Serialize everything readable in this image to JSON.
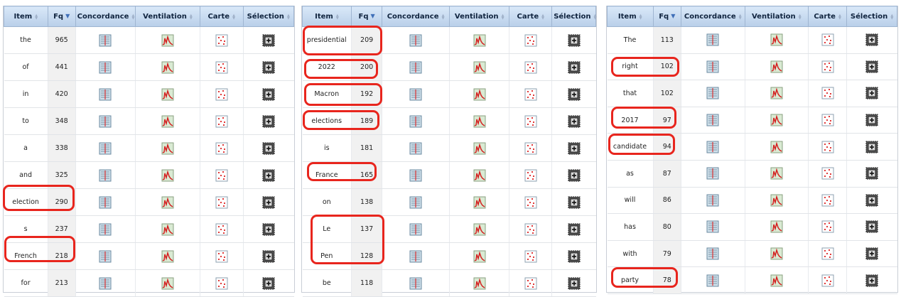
{
  "columns": {
    "item": "Item",
    "fq": "Fq",
    "concordance": "Concordance",
    "ventilation": "Ventilation",
    "carte": "Carte",
    "selection": "Sélection"
  },
  "icons": {
    "concordance": "concordance-icon",
    "ventilation": "ventilation-chart-icon",
    "carte": "map-dots-icon",
    "selection": "select-plus-icon"
  },
  "colors": {
    "highlight": "#e8251d",
    "header_top": "#d9e8f8",
    "header_bottom": "#b9cfe9",
    "sort_active": "#3f6fb8"
  },
  "panels": [
    {
      "rows": [
        {
          "item": "the",
          "fq": "965"
        },
        {
          "item": "of",
          "fq": "441"
        },
        {
          "item": "in",
          "fq": "420"
        },
        {
          "item": "to",
          "fq": "348"
        },
        {
          "item": "a",
          "fq": "338"
        },
        {
          "item": "and",
          "fq": "325"
        },
        {
          "item": "election",
          "fq": "290"
        },
        {
          "item": "s",
          "fq": "237"
        },
        {
          "item": "French",
          "fq": "218"
        },
        {
          "item": "for",
          "fq": "213"
        }
      ]
    },
    {
      "rows": [
        {
          "item": "presidential",
          "fq": "209"
        },
        {
          "item": "2022",
          "fq": "200"
        },
        {
          "item": "Macron",
          "fq": "192"
        },
        {
          "item": "elections",
          "fq": "189"
        },
        {
          "item": "is",
          "fq": "181"
        },
        {
          "item": "France",
          "fq": "165"
        },
        {
          "item": "on",
          "fq": "138"
        },
        {
          "item": "Le",
          "fq": "137"
        },
        {
          "item": "Pen",
          "fq": "128"
        },
        {
          "item": "be",
          "fq": "118"
        }
      ]
    },
    {
      "rows": [
        {
          "item": "The",
          "fq": "113"
        },
        {
          "item": "right",
          "fq": "102"
        },
        {
          "item": "that",
          "fq": "102"
        },
        {
          "item": "2017",
          "fq": "97"
        },
        {
          "item": "candidate",
          "fq": "94"
        },
        {
          "item": "as",
          "fq": "87"
        },
        {
          "item": "will",
          "fq": "86"
        },
        {
          "item": "has",
          "fq": "80"
        },
        {
          "item": "with",
          "fq": "79"
        },
        {
          "item": "party",
          "fq": "78"
        }
      ]
    }
  ]
}
